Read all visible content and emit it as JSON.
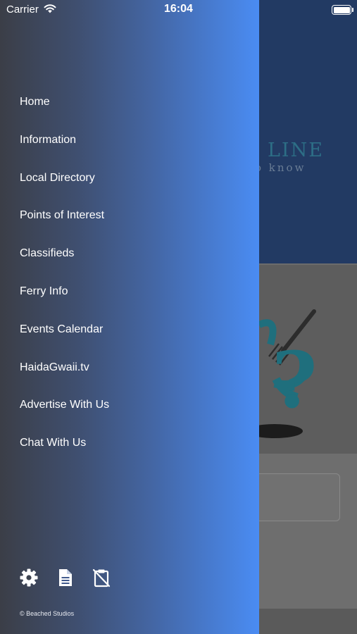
{
  "status_bar": {
    "carrier": "Carrier",
    "time": "16:04"
  },
  "background": {
    "logo_text": "LINE",
    "tagline": "o know"
  },
  "menu": {
    "items": [
      {
        "label": "Home"
      },
      {
        "label": "Information"
      },
      {
        "label": "Local Directory"
      },
      {
        "label": "Points of Interest"
      },
      {
        "label": "Classifieds"
      },
      {
        "label": "Ferry Info"
      },
      {
        "label": "Events Calendar"
      },
      {
        "label": "HaidaGwaii.tv"
      },
      {
        "label": "Advertise With Us"
      },
      {
        "label": "Chat With Us"
      }
    ]
  },
  "toolbar": {
    "icons": [
      "gear-icon",
      "document-icon",
      "clipboard-off-icon"
    ]
  },
  "footer": {
    "copyright": "© Beached Studios"
  },
  "colors": {
    "drawer_gradient_start": "#3b3e47",
    "drawer_gradient_end": "#4a8cf3",
    "background_header": "#223a63",
    "text": "#ffffff"
  }
}
